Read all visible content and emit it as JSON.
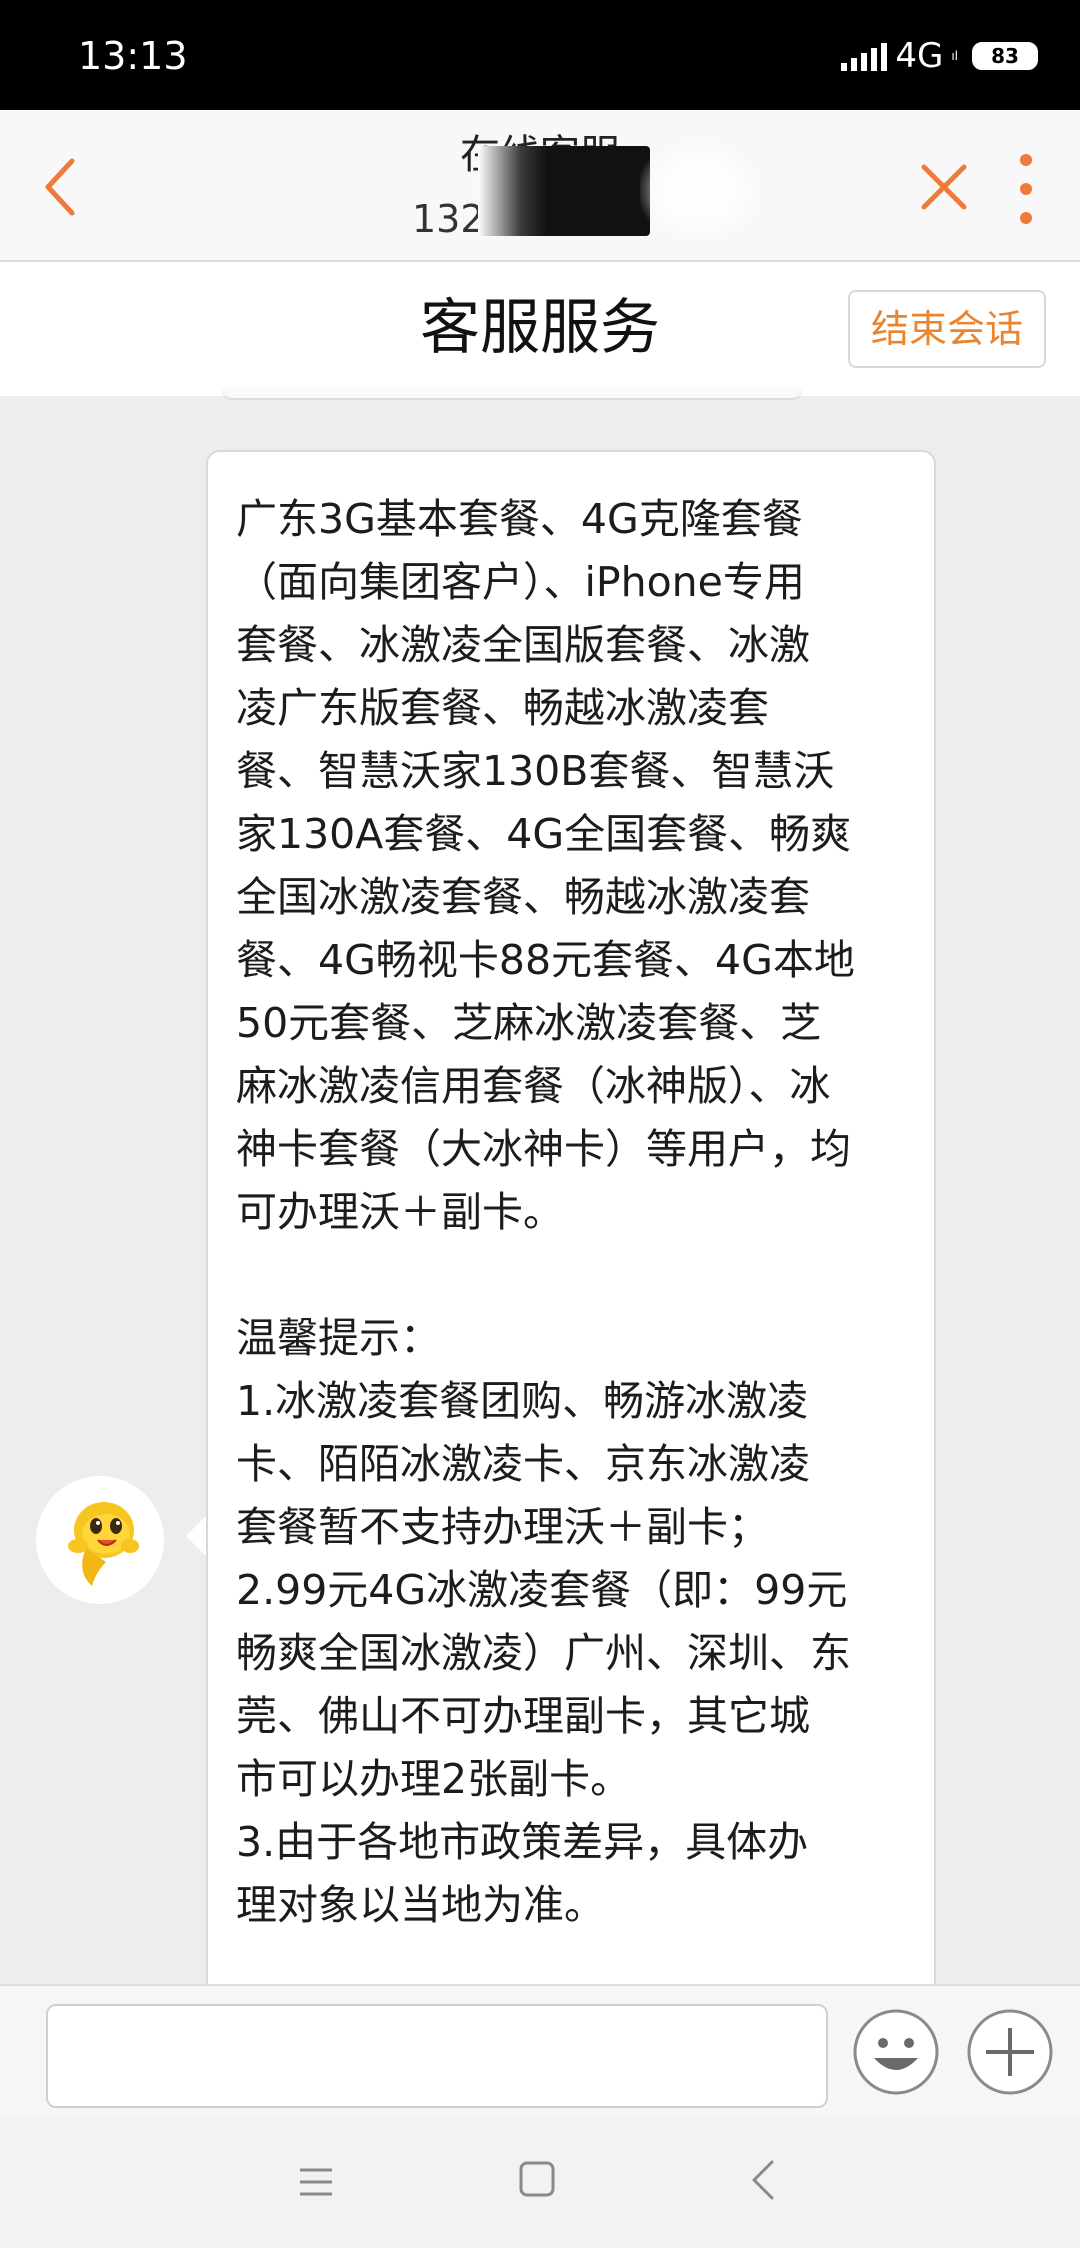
{
  "status_bar": {
    "time": "13:13",
    "network": "4G",
    "network_sub": "ıl",
    "battery": "83"
  },
  "header": {
    "title": "在线客服",
    "subtitle": "132",
    "accent_color": "#ef7b3a",
    "icons": [
      "back-chevron-icon",
      "close-icon",
      "more-vertical-icon"
    ]
  },
  "service_bar": {
    "title": "客服服务",
    "end_button": "结束会话"
  },
  "message": {
    "text": "广东3G基本套餐、4G克隆套餐\n（面向集团客户）、iPhone专用\n套餐、冰激凌全国版套餐、冰激\n凌广东版套餐、畅越冰激凌套\n餐、智慧沃家130B套餐、智慧沃\n家130A套餐、4G全国套餐、畅爽\n全国冰激凌套餐、畅越冰激凌套\n餐、4G畅视卡88元套餐、4G本地\n50元套餐、芝麻冰激凌套餐、芝\n麻冰激凌信用套餐（冰神版）、冰\n神卡套餐（大冰神卡）等用户，均\n可办理沃＋副卡。\n\n温馨提示：\n1.冰激凌套餐团购、畅游冰激凌\n卡、陌陌冰激凌卡、京东冰激凌\n套餐暂不支持办理沃＋副卡；\n2.99元4G冰激凌套餐（即：99元\n畅爽全国冰激凌）广州、深圳、东\n莞、佛山不可办理副卡，其它城\n市可以办理2张副卡。\n3.由于各地市政策差异，具体办\n理对象以当地为准。"
  },
  "input_bar": {
    "placeholder": "",
    "icons": [
      "smiley-icon",
      "plus-icon"
    ]
  },
  "nav_bar": {
    "icons": [
      "menu-icon",
      "home-square-icon",
      "back-triangle-icon"
    ]
  }
}
